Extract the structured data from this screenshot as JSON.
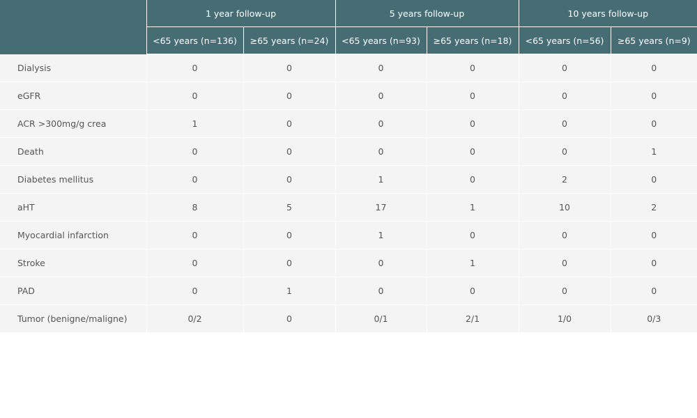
{
  "header": {
    "groups": [
      "1 year follow-up",
      "5 years follow-up",
      "10 years follow-up"
    ],
    "subheaders": [
      "<65 years (n=136)",
      "≥65 years (n=24)",
      "<65 years (n=93)",
      "≥65 years (n=18)",
      "<65 years (n=56)",
      "≥65 years (n=9)"
    ]
  },
  "rows": [
    {
      "label": "Dialysis",
      "values": [
        "0",
        "0",
        "0",
        "0",
        "0",
        "0"
      ]
    },
    {
      "label": "eGFR",
      "values": [
        "0",
        "0",
        "0",
        "0",
        "0",
        "0"
      ]
    },
    {
      "label": "ACR >300mg/g crea",
      "values": [
        "1",
        "0",
        "0",
        "0",
        "0",
        "0"
      ]
    },
    {
      "label": "Death",
      "values": [
        "0",
        "0",
        "0",
        "0",
        "0",
        "1"
      ]
    },
    {
      "label": "Diabetes mellitus",
      "values": [
        "0",
        "0",
        "1",
        "0",
        "2",
        "0"
      ]
    },
    {
      "label": "aHT",
      "values": [
        "8",
        "5",
        "17",
        "1",
        "10",
        "2"
      ]
    },
    {
      "label": "Myocardial infarction",
      "values": [
        "0",
        "0",
        "1",
        "0",
        "0",
        "0"
      ]
    },
    {
      "label": "Stroke",
      "values": [
        "0",
        "0",
        "0",
        "1",
        "0",
        "0"
      ]
    },
    {
      "label": "PAD",
      "values": [
        "0",
        "1",
        "0",
        "0",
        "0",
        "0"
      ]
    },
    {
      "label": "Tumor (benigne/maligne)",
      "values": [
        "0/2",
        "0",
        "0/1",
        "2/1",
        "1/0",
        "0/3"
      ]
    }
  ],
  "colors": {
    "header_bg": "#456d73",
    "header_text": "#ffffff",
    "row_bg": "#f4f4f4",
    "cell_text": "#555555"
  }
}
